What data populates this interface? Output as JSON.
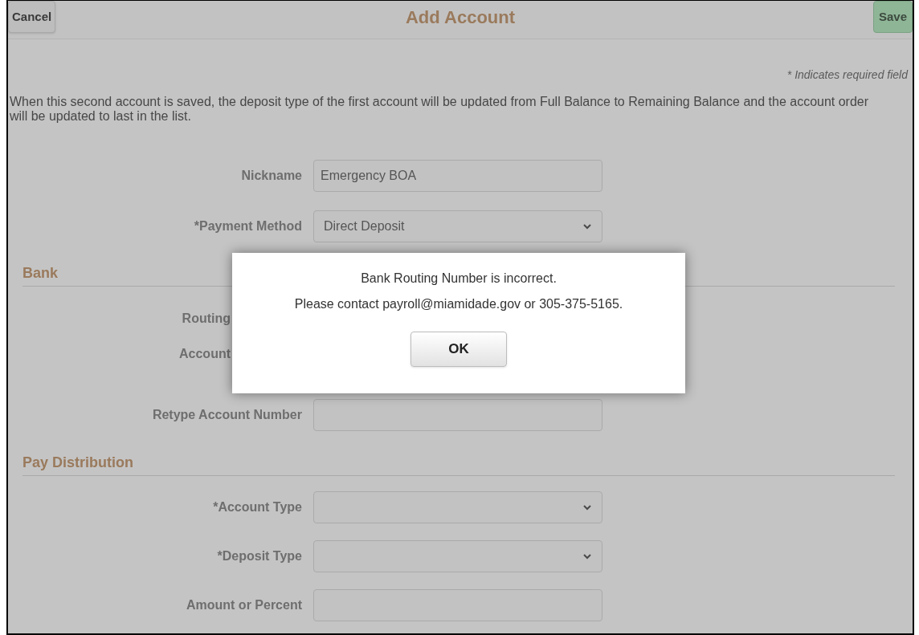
{
  "header": {
    "cancel": "Cancel",
    "title": "Add Account",
    "save": "Save"
  },
  "required_note": "* Indicates required field",
  "notice": "When this second account is saved, the deposit type of the first account will be updated from Full Balance to Remaining Balance and the account order will be updated to last in the list.",
  "sections": [
    {
      "fields": [
        {
          "kind": "input",
          "label": "Nickname",
          "value": "Emergency BOA"
        },
        {
          "kind": "select",
          "label": "*Payment Method",
          "value": "Direct Deposit"
        }
      ]
    },
    {
      "heading": "Bank",
      "fields": [
        {
          "kind": "covered",
          "label": "Routing"
        },
        {
          "kind": "covered",
          "label": "Account"
        },
        {
          "kind": "input",
          "label": "Retype Account Number"
        }
      ]
    },
    {
      "heading": "Pay Distribution",
      "fields": [
        {
          "kind": "select",
          "label": "*Account Type"
        },
        {
          "kind": "select",
          "label": "*Deposit Type"
        },
        {
          "kind": "input",
          "label": "Amount or Percent"
        }
      ]
    }
  ],
  "dialog": {
    "lines": [
      "Bank Routing Number is incorrect.",
      "Please contact payroll@miamidade.gov or 305-375-5165."
    ],
    "button": "OK"
  }
}
